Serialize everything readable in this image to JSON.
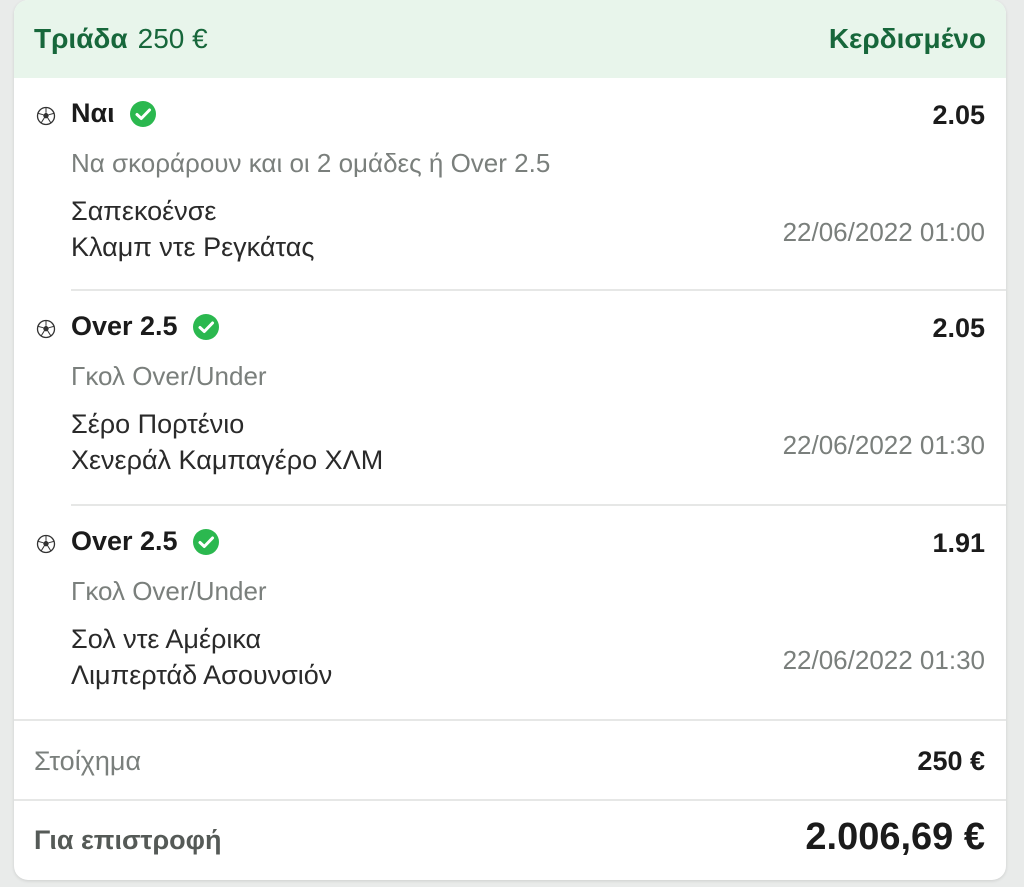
{
  "header": {
    "bet_type": "Τριάδα",
    "bet_amount": "250 €",
    "status": "Κερδισμένο"
  },
  "colors": {
    "accent_green": "#17673b",
    "check_green": "#2bb84f",
    "header_bg": "#e8f5eb"
  },
  "selections": [
    {
      "icon": "soccer-ball-icon",
      "pick": "Ναι",
      "odds": "2.05",
      "market": "Να σκοράρουν και οι 2 ομάδες ή Over 2.5",
      "home_team": "Σαπεκοένσε",
      "away_team": "Κλαμπ ντε Ρεγκάτας",
      "datetime": "22/06/2022 01:00",
      "result": "won"
    },
    {
      "icon": "soccer-ball-icon",
      "pick": "Over 2.5",
      "odds": "2.05",
      "market": "Γκολ Over/Under",
      "home_team": "Σέρο Πορτένιο",
      "away_team": "Χενεράλ Καμπαγέρο ΧΛΜ",
      "datetime": "22/06/2022 01:30",
      "result": "won"
    },
    {
      "icon": "soccer-ball-icon",
      "pick": "Over 2.5",
      "odds": "1.91",
      "market": "Γκολ Over/Under",
      "home_team": "Σολ ντε Αμέρικα",
      "away_team": "Λιμπερτάδ Ασουνσιόν",
      "datetime": "22/06/2022 01:30",
      "result": "won"
    }
  ],
  "summary": {
    "stake_label": "Στοίχημα",
    "stake_value": "250 €",
    "return_label": "Για επιστροφή",
    "return_value": "2.006,69 €"
  }
}
